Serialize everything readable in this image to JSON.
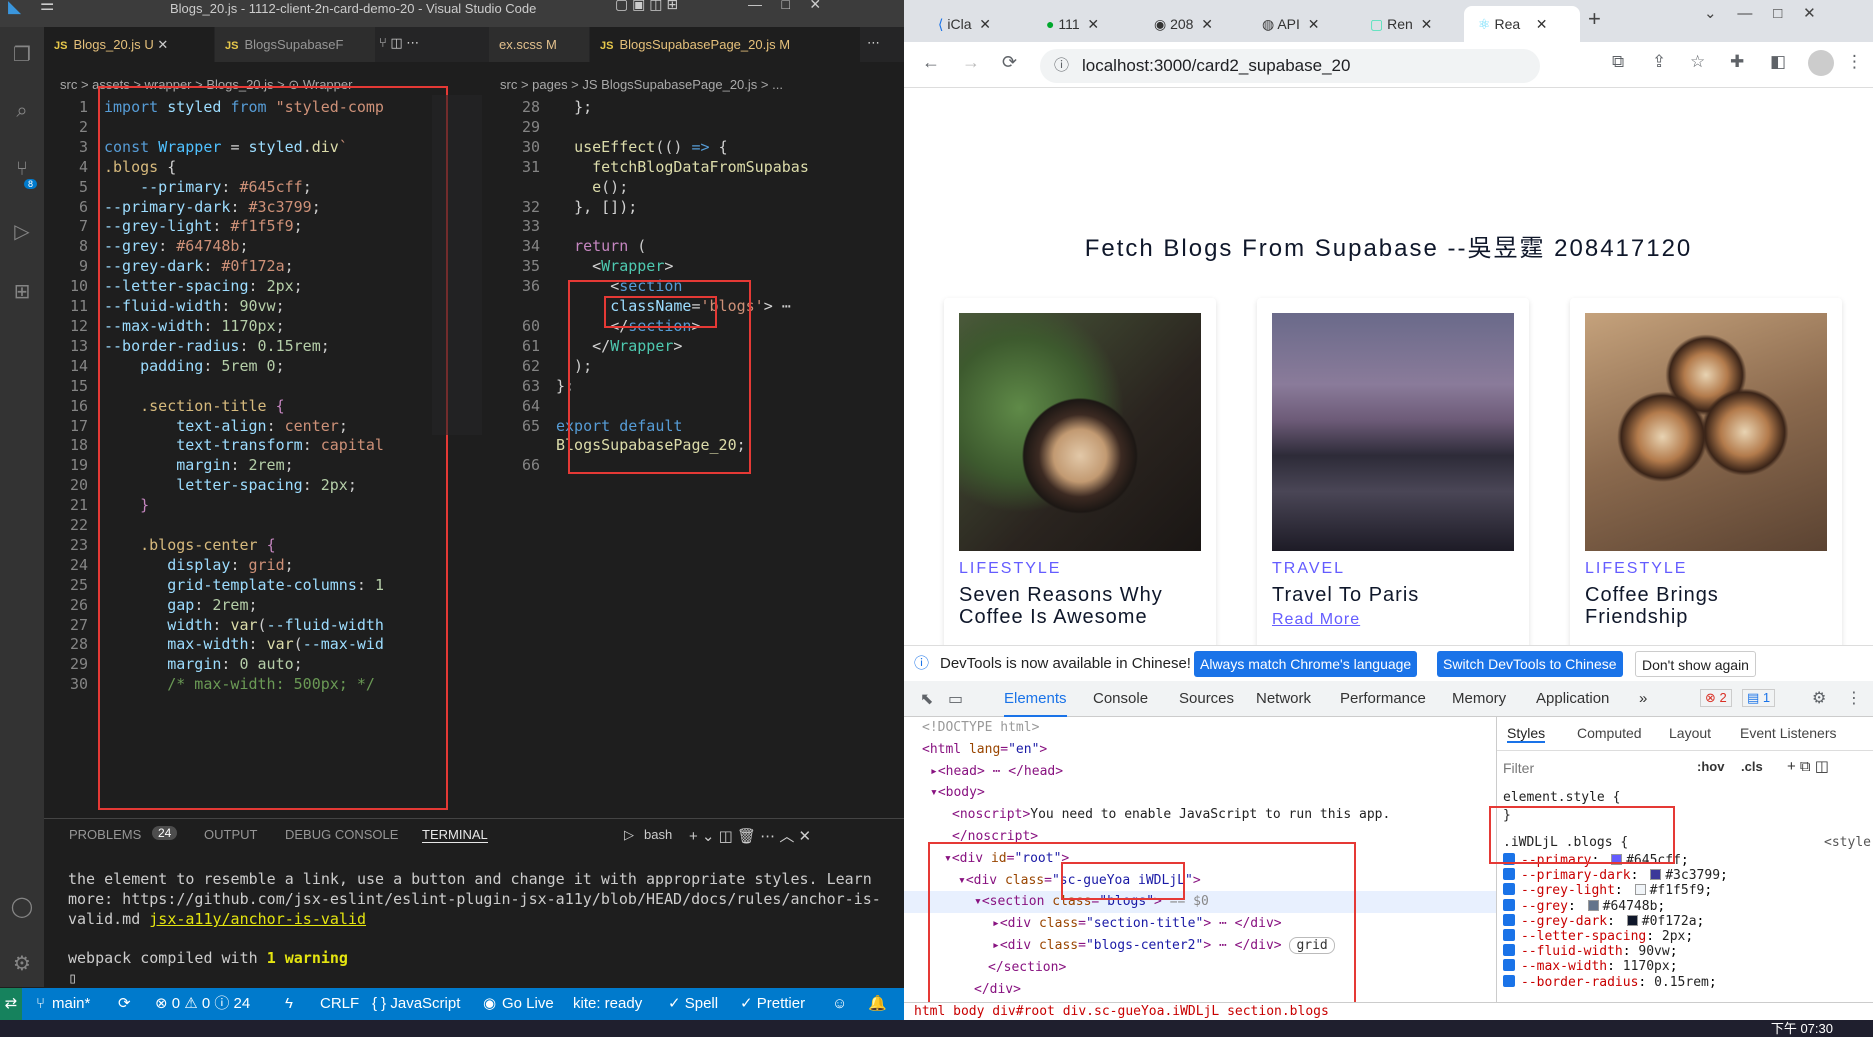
{
  "vscode": {
    "title": "Blogs_20.js - 1112-client-2n-card-demo-20 - Visual Studio Code",
    "tabs": [
      {
        "label": "Blogs_20.js",
        "badge": "U"
      },
      {
        "label": "BlogsSupabaseF"
      },
      {
        "label": "ex.scss",
        "badge": "M"
      },
      {
        "label": "BlogsSupabasePage_20.js",
        "badge": "M"
      }
    ],
    "left_breadcrumb": "src > assets > wrapper > Blogs_20.js > ⊙ Wrapper",
    "right_breadcrumb": "src > pages > JS BlogsSupabasePage_20.js > ...",
    "scm_badge": "8",
    "panel_tabs": [
      "PROBLEMS",
      "OUTPUT",
      "DEBUG CONSOLE",
      "TERMINAL"
    ],
    "problems_count": "24",
    "shell": "bash",
    "terminal_line1": "the element to resemble a link, use a button and change it with appropriate styles. Learn",
    "terminal_line2": "more: https://github.com/jsx-eslint/eslint-plugin-jsx-a11y/blob/HEAD/docs/rules/anchor-is-",
    "terminal_line3": "valid.md",
    "terminal_rule": "jsx-a11y/anchor-is-valid",
    "terminal_compiled": "webpack compiled with ",
    "terminal_warning": "1 warning",
    "status": {
      "branch": "main*",
      "errors": "⊗ 0 ⚠ 0 ⓘ 24",
      "lineending": "CRLF",
      "language": "{ } JavaScript",
      "golive": "Go Live",
      "kite": "kite: ready",
      "spell": "✓ Spell",
      "prettier": "✓ Prettier"
    }
  },
  "chrome": {
    "tabs": [
      "iCla",
      "111",
      "208",
      "API",
      "Ren",
      "Rea"
    ],
    "url": "localhost:3000/card2_supabase_20",
    "page_title": "Fetch Blogs From Supabase --吳昱霆 208417120",
    "cards": [
      {
        "category": "LIFESTYLE",
        "title": "Seven Reasons Why Coffee Is Awesome"
      },
      {
        "category": "TRAVEL",
        "title": "Travel To Paris",
        "link": "Read More"
      },
      {
        "category": "LIFESTYLE",
        "title": "Coffee Brings Friendship"
      }
    ],
    "notice": {
      "text": "DevTools is now available in Chinese!",
      "btn1": "Always match Chrome's language",
      "btn2": "Switch DevTools to Chinese",
      "btn3": "Don't show again"
    },
    "devtools_tabs": [
      "Elements",
      "Console",
      "Sources",
      "Network",
      "Performance",
      "Memory",
      "Application"
    ],
    "errors_badge": "2",
    "messages_badge": "1",
    "styles_tabs": [
      "Styles",
      "Computed",
      "Layout",
      "Event Listeners"
    ],
    "filter_placeholder": "Filter",
    "hov": ":hov",
    "cls": ".cls",
    "rule_selector": ".iWDLjL .blogs {",
    "rule_source": "<style",
    "style_props": [
      {
        "name": "--primary",
        "value": "#645cff",
        "swatch": "#645cff"
      },
      {
        "name": "--primary-dark",
        "value": "#3c3799",
        "swatch": "#3c3799"
      },
      {
        "name": "--grey-light",
        "value": "#f1f5f9",
        "swatch": "#f1f5f9"
      },
      {
        "name": "--grey",
        "value": "#64748b",
        "swatch": "#64748b"
      },
      {
        "name": "--grey-dark",
        "value": "#0f172a",
        "swatch": "#0f172a"
      },
      {
        "name": "--letter-spacing",
        "value": "2px"
      },
      {
        "name": "--fluid-width",
        "value": "90vw"
      },
      {
        "name": "--max-width",
        "value": "1170px"
      },
      {
        "name": "--border-radius",
        "value": "0.15rem"
      }
    ],
    "dom_breadcrumb": "html  body  div#root  div.sc-gueYoa.iWDLjL  section.blogs"
  },
  "taskbar_time": "下午 07:30"
}
